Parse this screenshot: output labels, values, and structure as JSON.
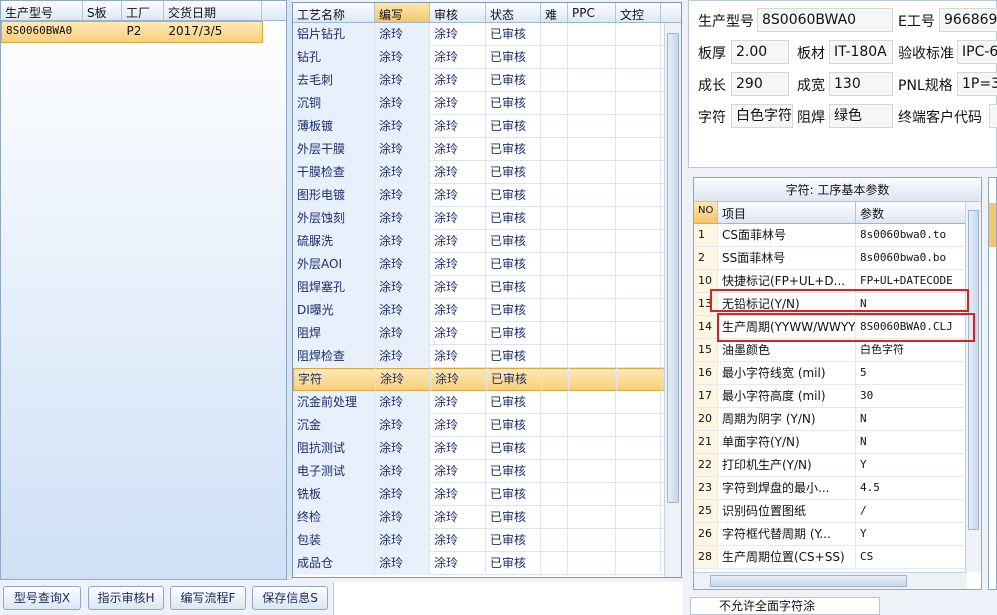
{
  "model_list": {
    "headers": [
      "生产型号",
      "S板",
      "工厂",
      "交货日期"
    ],
    "rows": [
      {
        "model": "8S0060BWA0",
        "s": "",
        "factory": "P2",
        "date": "2017/3/5"
      }
    ]
  },
  "process_table": {
    "headers": [
      "工艺名称",
      "编写",
      "审核",
      "状态",
      "难",
      "PPC",
      "文控"
    ],
    "rows": [
      [
        "铝片钻孔",
        "涂玲",
        "涂玲",
        "已审核"
      ],
      [
        "钻孔",
        "涂玲",
        "涂玲",
        "已审核"
      ],
      [
        "去毛刺",
        "涂玲",
        "涂玲",
        "已审核"
      ],
      [
        "沉铜",
        "涂玲",
        "涂玲",
        "已审核"
      ],
      [
        "薄板镀",
        "涂玲",
        "涂玲",
        "已审核"
      ],
      [
        "外层干膜",
        "涂玲",
        "涂玲",
        "已审核"
      ],
      [
        "干膜检查",
        "涂玲",
        "涂玲",
        "已审核"
      ],
      [
        "图形电镀",
        "涂玲",
        "涂玲",
        "已审核"
      ],
      [
        "外层蚀刻",
        "涂玲",
        "涂玲",
        "已审核"
      ],
      [
        "硫脲洗",
        "涂玲",
        "涂玲",
        "已审核"
      ],
      [
        "外层AOI",
        "涂玲",
        "涂玲",
        "已审核"
      ],
      [
        "阻焊塞孔",
        "涂玲",
        "涂玲",
        "已审核"
      ],
      [
        "DI曝光",
        "涂玲",
        "涂玲",
        "已审核"
      ],
      [
        "阻焊",
        "涂玲",
        "涂玲",
        "已审核"
      ],
      [
        "阻焊检查",
        "涂玲",
        "涂玲",
        "已审核"
      ],
      [
        "字符",
        "涂玲",
        "涂玲",
        "已审核"
      ],
      [
        "沉金前处理",
        "涂玲",
        "涂玲",
        "已审核"
      ],
      [
        "沉金",
        "涂玲",
        "涂玲",
        "已审核"
      ],
      [
        "阻抗测试",
        "涂玲",
        "涂玲",
        "已审核"
      ],
      [
        "电子测试",
        "涂玲",
        "涂玲",
        "已审核"
      ],
      [
        "铣板",
        "涂玲",
        "涂玲",
        "已审核"
      ],
      [
        "终检",
        "涂玲",
        "涂玲",
        "已审核"
      ],
      [
        "包装",
        "涂玲",
        "涂玲",
        "已审核"
      ],
      [
        "成品仓",
        "涂玲",
        "涂玲",
        "已审核"
      ]
    ],
    "selected_index": 15
  },
  "info": {
    "model_label": "生产型号",
    "model_value": "8S0060BWA0",
    "engineer_label": "E工号",
    "engineer_value": "966869",
    "thickness_label": "板厚",
    "thickness_value": "2.00",
    "material_label": "板材",
    "material_value": "IT-180A",
    "standard_label": "验收标准",
    "standard_value": "IPC-6",
    "length_label": "成长",
    "length_value": "290",
    "width_label": "成宽",
    "width_value": "130",
    "pnl_label": "PNL规格",
    "pnl_value": "1P=3",
    "char_label": "字符",
    "char_value": "白色字符",
    "mask_label": "阻焊",
    "mask_value": "绿色",
    "customer_label": "终端客户代码",
    "customer_value": ""
  },
  "params": {
    "title": "字符: 工序基本参数",
    "headers": [
      "NO",
      "项目",
      "参数"
    ],
    "rows": [
      [
        "1",
        "CS面菲林号",
        "8s0060bwa0.to"
      ],
      [
        "2",
        "SS面菲林号",
        "8s0060bwa0.bo"
      ],
      [
        "10",
        "快捷标记(FP+UL+D...",
        "FP+UL+DATECODE"
      ],
      [
        "13",
        "无铅标记(Y/N)",
        "N"
      ],
      [
        "14",
        "生产周期(YYWW/WWYY)",
        "8S0060BWA0.CLJ"
      ],
      [
        "15",
        "油墨颜色",
        "白色字符"
      ],
      [
        "16",
        "最小字符线宽 (mil)",
        "5"
      ],
      [
        "17",
        "最小字符高度 (mil)",
        "30"
      ],
      [
        "20",
        "周期为阴字 (Y/N)",
        "N"
      ],
      [
        "21",
        "单面字符(Y/N)",
        "N"
      ],
      [
        "22",
        "打印机生产(Y/N)",
        "Y"
      ],
      [
        "23",
        "字符到焊盘的最小...",
        "4.5"
      ],
      [
        "25",
        "识别码位置图纸",
        "/"
      ],
      [
        "26",
        "字符框代替周期 (Y...",
        "Y"
      ],
      [
        "28",
        "生产周期位置(CS+SS)",
        "CS"
      ]
    ]
  },
  "buttons": {
    "query": "型号查询X",
    "review": "指示审核H",
    "flow": "编写流程F",
    "save": "保存信息S"
  },
  "bottom_check": "不允许全面字符涂",
  "colors": {
    "selection": "#f7cf7a",
    "highlight_box": "#e02020",
    "panel_bg": "#d6e4f5"
  }
}
